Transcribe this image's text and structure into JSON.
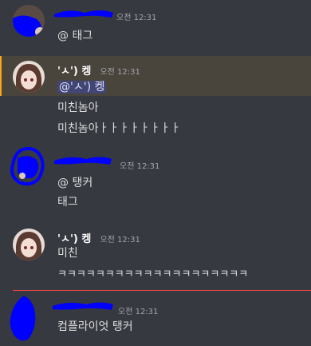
{
  "messages": [
    {
      "id": "m1",
      "author": "",
      "time": "오전 12:31",
      "lines": [
        "@ 태그"
      ]
    },
    {
      "id": "m2",
      "author": "'ㅅ') 켕",
      "time": "오전 12:31",
      "mention": "@'ㅅ') 켕",
      "lines": [
        "미친놈아",
        "미친놈아ㅏㅏㅏㅏㅏㅏㅏㅏ"
      ]
    },
    {
      "id": "m3",
      "author": "",
      "time": "오전 12:31",
      "lines": [
        "@ 탱커",
        "태그"
      ]
    },
    {
      "id": "m4",
      "author": "'ㅅ') 켕",
      "time": "오전 12:31",
      "lines": [
        "미친",
        "ㅋㅋㅋㅋㅋㅋㅋㅋㅋㅋㅋㅋㅋㅋㅋㅋㅋㅋㅋㅋ"
      ]
    },
    {
      "id": "m5",
      "author": "",
      "time": "오전 12:31",
      "lines": [
        "컴플라이엇 탱커"
      ]
    }
  ],
  "colors": {
    "background": "#36393f",
    "highlight": "#49443c",
    "highlight_border": "#faa61a",
    "mention_pill": "#414675",
    "new_divider": "#ed4245",
    "redaction": "#0000ff"
  }
}
